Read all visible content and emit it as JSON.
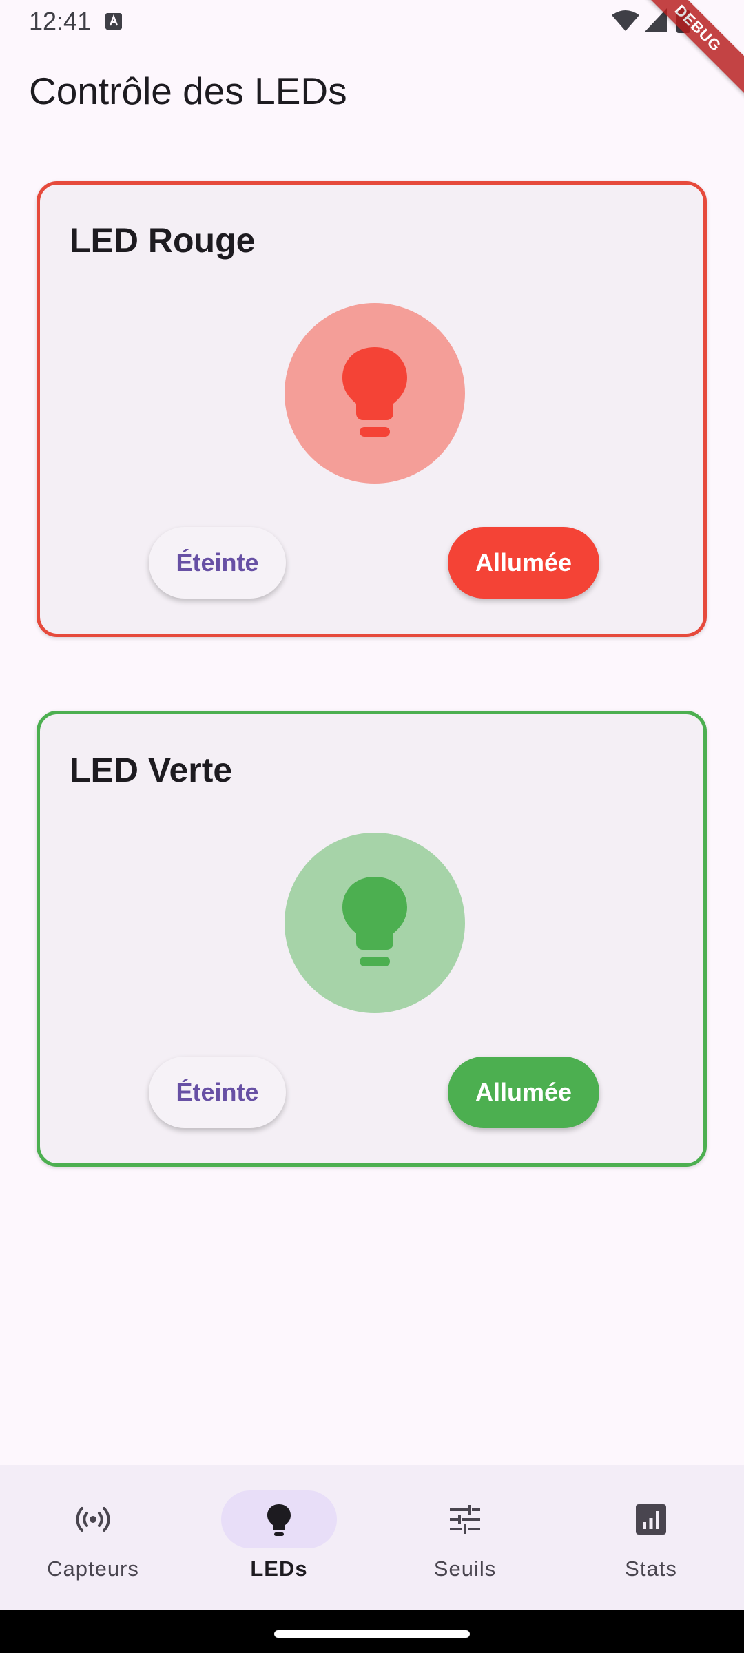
{
  "status_bar": {
    "time": "12:41"
  },
  "debug_ribbon": "DEBUG",
  "app_bar": {
    "title": "Contrôle des LEDs"
  },
  "leds": [
    {
      "title": "LED Rouge",
      "off_label": "Éteinte",
      "on_label": "Allumée",
      "state": "on",
      "color": "#f44336"
    },
    {
      "title": "LED Verte",
      "off_label": "Éteinte",
      "on_label": "Allumée",
      "state": "on",
      "color": "#4caf50"
    }
  ],
  "bottom_nav": {
    "items": [
      {
        "label": "Capteurs",
        "icon": "sensors-icon"
      },
      {
        "label": "LEDs",
        "icon": "lightbulb-icon",
        "active": true
      },
      {
        "label": "Seuils",
        "icon": "tune-icon"
      },
      {
        "label": "Stats",
        "icon": "bar-chart-icon"
      }
    ]
  },
  "colors": {
    "accent": "#6750a4",
    "nav_indicator": "#e8def8",
    "background": "#fdf7fd"
  }
}
